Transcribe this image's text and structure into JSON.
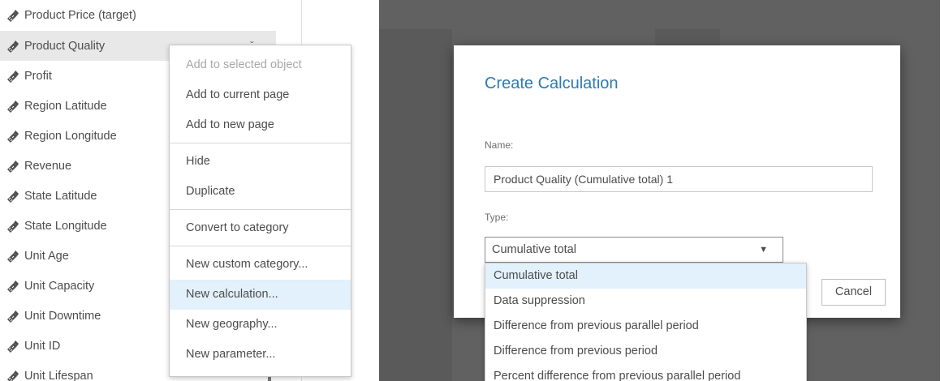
{
  "data_pane": {
    "fields": [
      {
        "label": "Product Price (target)",
        "icon": "measure-icon"
      },
      {
        "label": "Product Quality",
        "icon": "measure-icon",
        "selected": true
      },
      {
        "label": "Profit",
        "icon": "measure-icon"
      },
      {
        "label": "Region Latitude",
        "icon": "measure-icon"
      },
      {
        "label": "Region Longitude",
        "icon": "measure-icon"
      },
      {
        "label": "Revenue",
        "icon": "measure-icon"
      },
      {
        "label": "State Latitude",
        "icon": "measure-icon"
      },
      {
        "label": "State Longitude",
        "icon": "measure-icon"
      },
      {
        "label": "Unit Age",
        "icon": "measure-icon"
      },
      {
        "label": "Unit Capacity",
        "icon": "measure-icon"
      },
      {
        "label": "Unit Downtime",
        "icon": "measure-icon"
      },
      {
        "label": "Unit ID",
        "icon": "measure-icon"
      },
      {
        "label": "Unit Lifespan",
        "icon": "measure-icon"
      }
    ],
    "selected_item_menu_icon": "ˇ"
  },
  "context_menu": {
    "items": [
      {
        "label": "Add to selected object",
        "disabled": true
      },
      {
        "label": "Add to current page"
      },
      {
        "label": "Add to new page"
      },
      {
        "label": "Hide"
      },
      {
        "label": "Duplicate"
      },
      {
        "label": "Convert to category"
      },
      {
        "label": "New custom category..."
      },
      {
        "label": "New calculation...",
        "highlighted": true
      },
      {
        "label": "New geography..."
      },
      {
        "label": "New parameter..."
      }
    ]
  },
  "dialog": {
    "title": "Create Calculation",
    "name_label": "Name:",
    "name_value": "Product Quality (Cumulative total) 1",
    "type_label": "Type:",
    "type_selected": "Cumulative total",
    "type_options": [
      "Cumulative total",
      "Data suppression",
      "Difference from previous parallel period",
      "Difference from previous period",
      "Percent difference from previous parallel period"
    ],
    "cancel_label": "Cancel"
  },
  "colors": {
    "accent": "#2d7ab3",
    "highlight": "#e2f1fb",
    "overlay": "#5a5a5a",
    "text": "#4c4c4c"
  }
}
